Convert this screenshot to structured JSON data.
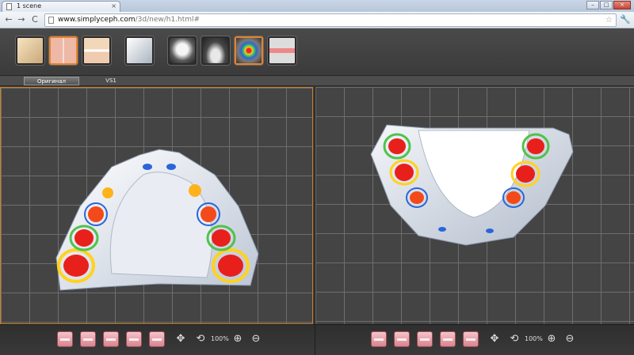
{
  "browser": {
    "tab_title": "1 scene",
    "tab_close": "×",
    "url_host": "www.simplyceph.com",
    "url_path": "/3d/new/h1.html#",
    "nav": {
      "back": "←",
      "forward": "→",
      "reload": "C"
    },
    "star": "☆",
    "menu": "🔧",
    "window": {
      "minimize": "–",
      "maximize": "□",
      "close": "×"
    }
  },
  "view_tabs": [
    "Оригинал",
    "VS1"
  ],
  "toolbar_buttons": [
    {
      "name": "view-1-button",
      "active": false
    },
    {
      "name": "view-split-vertical-button",
      "active": true
    },
    {
      "name": "view-split-horizontal-button",
      "active": false
    },
    {
      "name": "view-single-button",
      "active": false
    },
    {
      "name": "tooth-model-button",
      "active": false
    },
    {
      "name": "jaw-model-button",
      "active": false
    },
    {
      "name": "heatmap-button",
      "active": true
    },
    {
      "name": "occlusion-button",
      "active": false
    }
  ],
  "controls": {
    "move": "✥",
    "rotate": "⟲",
    "zoom_100": "100%",
    "zoom_in": "⊕",
    "zoom_out": "⊖"
  }
}
